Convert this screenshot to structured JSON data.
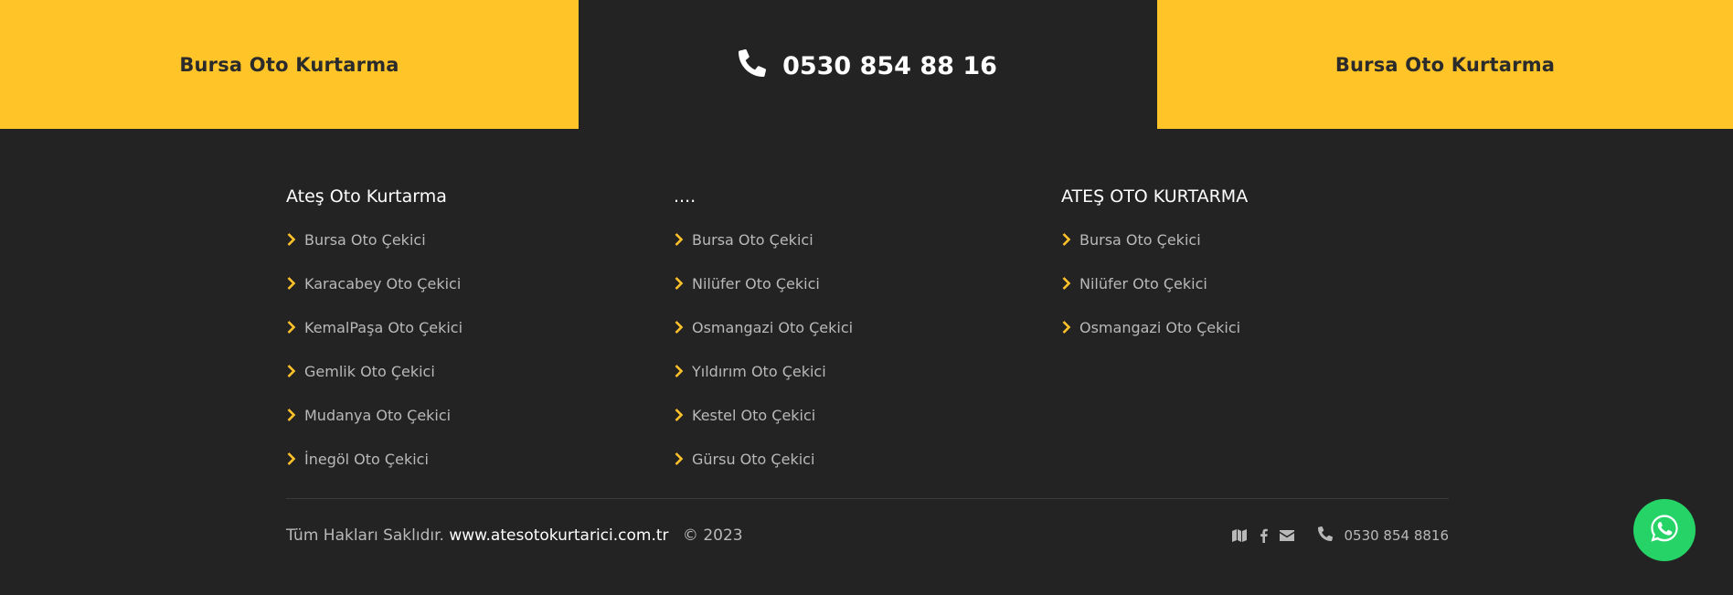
{
  "top_bar": {
    "left_label": "Bursa Oto Kurtarma",
    "phone": "0530 854 88 16",
    "right_label": "Bursa Oto Kurtarma"
  },
  "columns": [
    {
      "title": "Ateş Oto Kurtarma",
      "items": [
        {
          "label": "Bursa Oto Çekici"
        },
        {
          "label": "Karacabey Oto Çekici"
        },
        {
          "label": "KemalPaşa Oto Çekici"
        },
        {
          "label": "Gemlik Oto Çekici"
        },
        {
          "label": "Mudanya Oto Çekici"
        },
        {
          "label": "İnegöl Oto Çekici"
        }
      ]
    },
    {
      "title": "....",
      "items": [
        {
          "label": "Bursa Oto Çekici"
        },
        {
          "label": "Nilüfer Oto Çekici"
        },
        {
          "label": "Osmangazi Oto Çekici"
        },
        {
          "label": "Yıldırım Oto Çekici"
        },
        {
          "label": "Kestel Oto Çekici"
        },
        {
          "label": "Gürsu Oto Çekici"
        }
      ]
    },
    {
      "title": "ATEŞ OTO KURTARMA",
      "items": [
        {
          "label": "Bursa Oto Çekici"
        },
        {
          "label": "Nilüfer Oto Çekici"
        },
        {
          "label": "Osmangazi Oto Çekici"
        }
      ]
    }
  ],
  "bottom": {
    "rights_text": "Tüm Hakları Saklıdır.",
    "site": "www.atesotokurtarici.com.tr",
    "year": "© 2023",
    "phone": "0530 854 8816",
    "social_icons": [
      "map-icon",
      "facebook-icon",
      "envelope-icon"
    ]
  },
  "colors": {
    "accent": "#ffc428",
    "background": "#232323",
    "whatsapp": "#25d366"
  }
}
